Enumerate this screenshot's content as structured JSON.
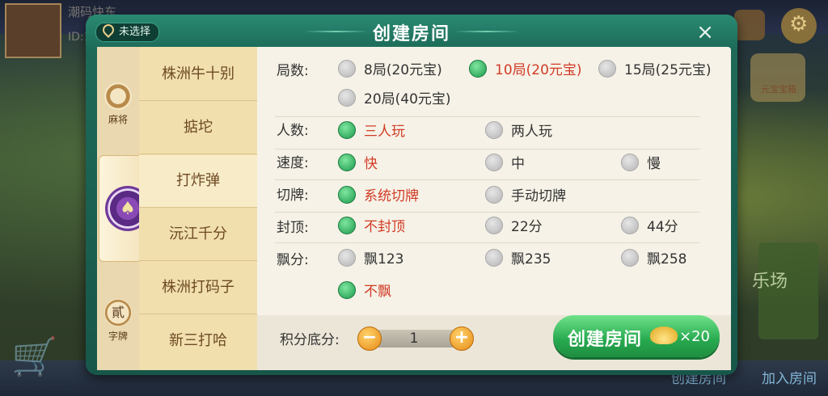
{
  "background": {
    "player_name": "潮码快东",
    "player_id": "ID:1",
    "chest_label": "元宝宝箱",
    "club_label": "乐场",
    "bottom_create": "创建房间",
    "bottom_join": "加入房间"
  },
  "dialog": {
    "title": "创建房间",
    "location": "未选择",
    "close_icon": "×",
    "categories": [
      {
        "label": "麻将",
        "icon": "mahjong-icon"
      },
      {
        "label": "",
        "icon": "spade-chip-icon"
      },
      {
        "label": "字牌",
        "icon": "zipai-icon",
        "glyph": "貳"
      }
    ],
    "games": [
      "株洲牛十别",
      "掂坨",
      "打炸弹",
      "沅江千分",
      "株洲打码子",
      "新三打哈"
    ],
    "selected_game": "打炸弹",
    "rows": {
      "rounds": {
        "label": "局数:",
        "options": [
          "8局(20元宝)",
          "10局(20元宝)",
          "15局(25元宝)",
          "20局(40元宝)"
        ],
        "selected": "10局(20元宝)"
      },
      "players": {
        "label": "人数:",
        "options": [
          "三人玩",
          "两人玩"
        ],
        "selected": "三人玩"
      },
      "speed": {
        "label": "速度:",
        "options": [
          "快",
          "中",
          "慢"
        ],
        "selected": "快"
      },
      "shuffle": {
        "label": "切牌:",
        "options": [
          "系统切牌",
          "手动切牌"
        ],
        "selected": "系统切牌"
      },
      "cap": {
        "label": "封顶:",
        "options": [
          "不封顶",
          "22分",
          "44分"
        ],
        "selected": "不封顶"
      },
      "float": {
        "label": "飘分:",
        "options": [
          "飘123",
          "飘235",
          "飘258",
          "不飘"
        ],
        "selected": "不飘"
      }
    },
    "score": {
      "label": "积分底分:",
      "value": "1",
      "minus": "−",
      "plus": "+"
    },
    "create_button": {
      "label": "创建房间",
      "cost": "×20"
    }
  },
  "colors": {
    "selected_text": "#d13b26",
    "accent_green": "#27a94f",
    "frame": "#1f6b5a"
  }
}
